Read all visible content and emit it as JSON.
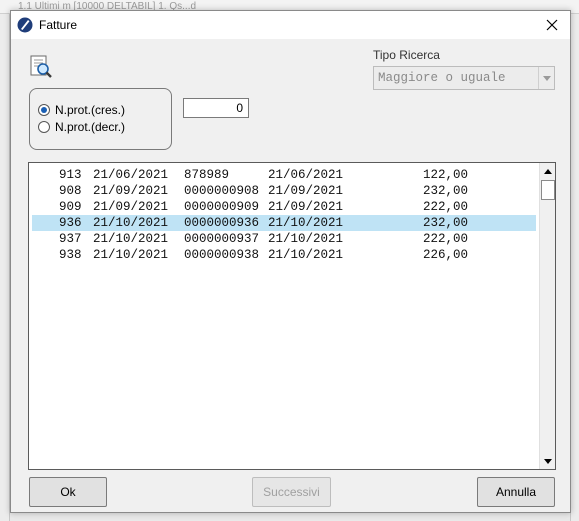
{
  "background": {
    "text": "1.1 Ultimi m    [10000 DELTABIL]         1. Qs...d"
  },
  "window": {
    "title": "Fatture",
    "close_icon": "close-icon"
  },
  "search": {
    "tipo_label": "Tipo Ricerca",
    "tipo_value": "Maggiore o uguale",
    "number_value": "0"
  },
  "radios": [
    {
      "label": "N.prot.(cres.)",
      "checked": true
    },
    {
      "label": "N.prot.(decr.)",
      "checked": false
    }
  ],
  "list": {
    "rows": [
      {
        "num": "913",
        "date": "21/06/2021",
        "doc": "878989",
        "date2": "21/06/2021",
        "amount": "122,00",
        "selected": false
      },
      {
        "num": "908",
        "date": "21/09/2021",
        "doc": "0000000908",
        "date2": "21/09/2021",
        "amount": "232,00",
        "selected": false
      },
      {
        "num": "909",
        "date": "21/09/2021",
        "doc": "0000000909",
        "date2": "21/09/2021",
        "amount": "222,00",
        "selected": false
      },
      {
        "num": "936",
        "date": "21/10/2021",
        "doc": "0000000936",
        "date2": "21/10/2021",
        "amount": "232,00",
        "selected": true
      },
      {
        "num": "937",
        "date": "21/10/2021",
        "doc": "0000000937",
        "date2": "21/10/2021",
        "amount": "222,00",
        "selected": false
      },
      {
        "num": "938",
        "date": "21/10/2021",
        "doc": "0000000938",
        "date2": "21/10/2021",
        "amount": "226,00",
        "selected": false
      }
    ],
    "selected_color": "#bfe3f5"
  },
  "buttons": {
    "ok": "Ok",
    "successivi": "Successivi",
    "annulla": "Annulla"
  }
}
